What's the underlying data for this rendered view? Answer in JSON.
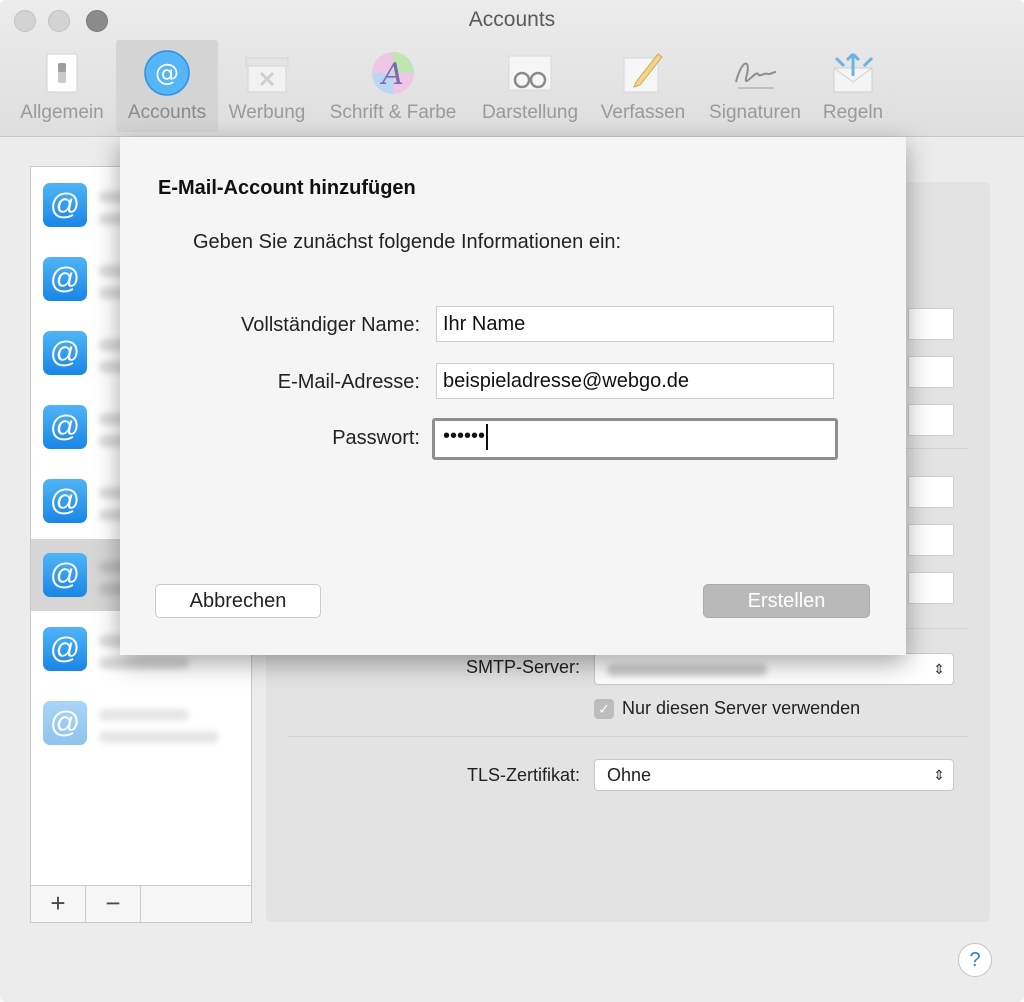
{
  "window": {
    "title": "Accounts"
  },
  "toolbar": {
    "items": [
      {
        "label": "Allgemein",
        "icon": "switch-icon"
      },
      {
        "label": "Accounts",
        "icon": "at-icon"
      },
      {
        "label": "Werbung",
        "icon": "junk-tray-icon"
      },
      {
        "label": "Schrift & Farbe",
        "icon": "font-color-icon"
      },
      {
        "label": "Darstellung",
        "icon": "glasses-icon"
      },
      {
        "label": "Verfassen",
        "icon": "pencil-icon"
      },
      {
        "label": "Signaturen",
        "icon": "signature-icon"
      },
      {
        "label": "Regeln",
        "icon": "rules-envelope-icon"
      }
    ],
    "active": "Accounts"
  },
  "accounts": {
    "badge": "@",
    "selected_index": 5,
    "count": 8
  },
  "list_footer": {
    "add": "+",
    "remove": "−"
  },
  "server_settings": {
    "smtp_label": "SMTP-Server:",
    "only_server_label": "Nur diesen Server verwenden",
    "only_server_checked": true,
    "tls_label": "TLS-Zertifikat:",
    "tls_value": "Ohne"
  },
  "help": "?",
  "dialog": {
    "title": "E-Mail-Account hinzufügen",
    "subtitle": "Geben Sie zunächst folgende Informationen ein:",
    "name_label": "Vollständiger Name:",
    "name_value": "Ihr Name",
    "email_label": "E-Mail-Adresse:",
    "email_value": "beispieladresse@webgo.de",
    "password_label": "Passwort:",
    "password_value": "••••••",
    "cancel": "Abbrechen",
    "create": "Erstellen"
  },
  "colors": {
    "accent": "#1a86e6",
    "disabled_button": "#b9b9b9"
  }
}
